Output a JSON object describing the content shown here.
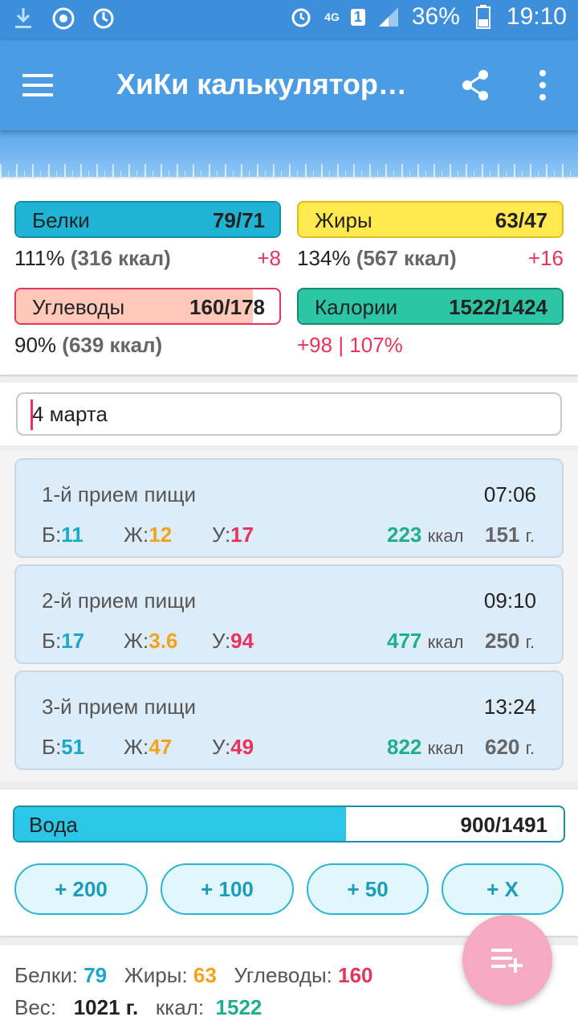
{
  "status_bar": {
    "network": "4G",
    "sim": "1",
    "battery": "36%",
    "time": "19:10"
  },
  "app_bar": {
    "title": "ХиКи калькулятор…"
  },
  "macros": {
    "protein": {
      "label": "Белки",
      "value": "79/71",
      "percent": "111%",
      "kcal": "(316 ккал)",
      "diff": "+8",
      "fill_fraction": 1.0
    },
    "fat": {
      "label": "Жиры",
      "value": "63/47",
      "percent": "134%",
      "kcal": "(567 ккал)",
      "diff": "+16",
      "fill_fraction": 1.0
    },
    "carbs": {
      "label": "Углеводы",
      "value": "160/178",
      "percent": "90%",
      "kcal": "(639 ккал)",
      "fill_fraction": 0.9
    },
    "calories": {
      "label": "Калории",
      "value": "1522/1424",
      "summary": "+98 | 107%",
      "fill_fraction": 1.0
    }
  },
  "date_field": {
    "value": "4 марта"
  },
  "meals": [
    {
      "name": "1-й прием пищи",
      "time": "07:06",
      "b_label": "Б:",
      "b": "11",
      "zh_label": "Ж:",
      "zh": "12",
      "u_label": "У:",
      "u": "17",
      "kcal": "223",
      "kcal_unit": "ккал",
      "grams": "151",
      "grams_unit": "г."
    },
    {
      "name": "2-й прием пищи",
      "time": "09:10",
      "b_label": "Б:",
      "b": "17",
      "zh_label": "Ж:",
      "zh": "3.6",
      "u_label": "У:",
      "u": "94",
      "kcal": "477",
      "kcal_unit": "ккал",
      "grams": "250",
      "grams_unit": "г."
    },
    {
      "name": "3-й прием пищи",
      "time": "13:24",
      "b_label": "Б:",
      "b": "51",
      "zh_label": "Ж:",
      "zh": "47",
      "u_label": "У:",
      "u": "49",
      "kcal": "822",
      "kcal_unit": "ккал",
      "grams": "620",
      "grams_unit": "г."
    }
  ],
  "water": {
    "label": "Вода",
    "value": "900/1491",
    "fill_fraction": 0.604,
    "buttons": [
      "+ 200",
      "+ 100",
      "+ 50",
      "+ X"
    ]
  },
  "summary": {
    "protein_label": "Белки:",
    "protein": "79",
    "fat_label": "Жиры:",
    "fat": "63",
    "carbs_label": "Углеводы:",
    "carbs": "160",
    "weight_label": "Вес:",
    "weight": "1021 г.",
    "kcal_label": "ккал:",
    "kcal": "1522"
  },
  "colors": {
    "primary": "#4a9de4",
    "protein": "#17a8cc",
    "fat": "#f4a21c",
    "carbs": "#e8335a",
    "calories": "#1fae8e",
    "water": "#2cc6e8",
    "fab": "#f5a9c3"
  },
  "icons": {
    "menu": "hamburger-menu-icon",
    "share": "share-icon",
    "more": "more-vert-icon",
    "fab": "playlist-add-icon"
  }
}
